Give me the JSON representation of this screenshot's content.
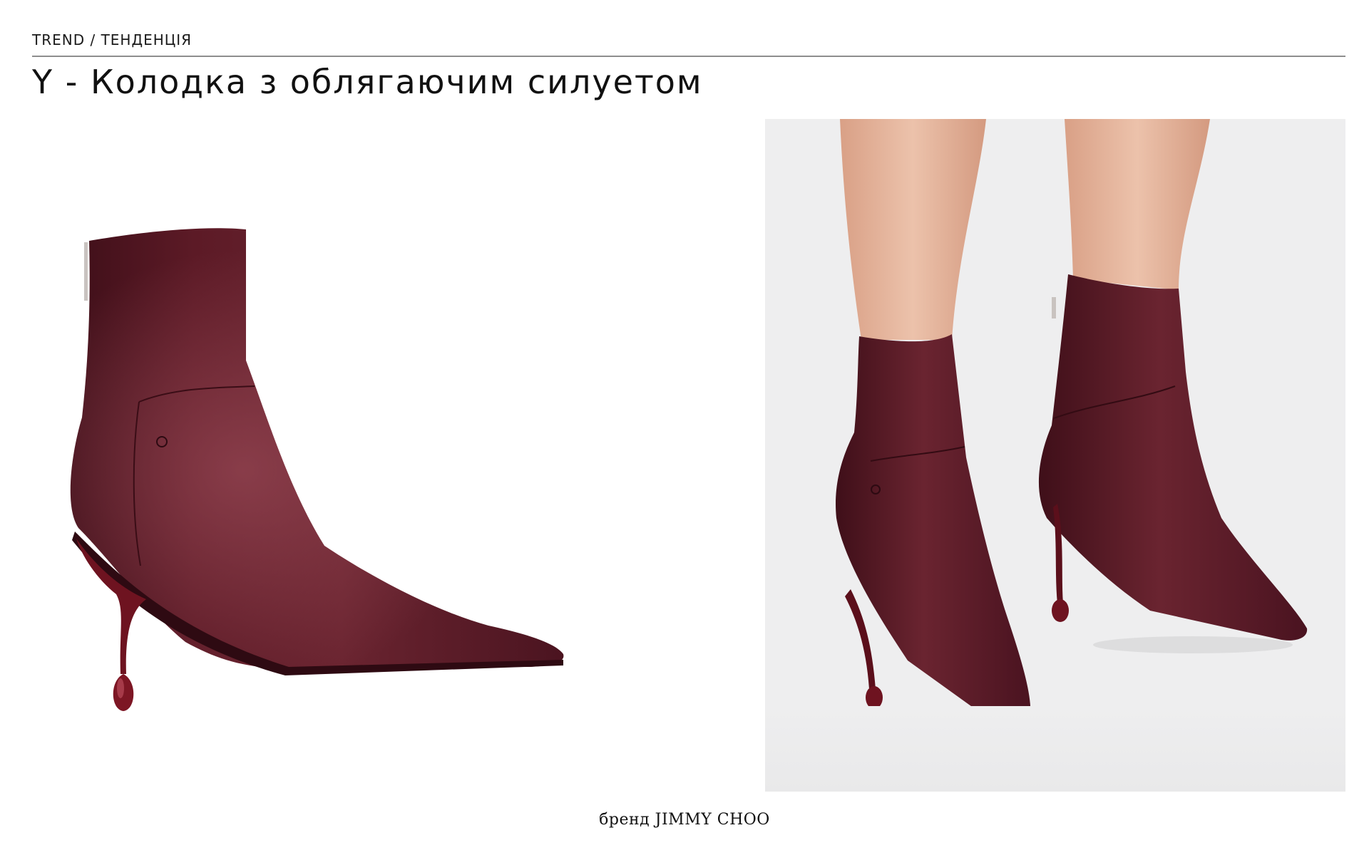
{
  "header": {
    "eyebrow": "TREND / ТЕНДЕНЦІЯ",
    "title": "Y - Колодка з облягаючим силуетом"
  },
  "footer": {
    "caption": "бренд JIMMY CHOO"
  },
  "colors": {
    "boot": "#5c1a26",
    "boot_shadow": "#3f0f19",
    "boot_highlight": "#8a3a47",
    "heel_lacquer": "#7d1624",
    "skin": "#e6b49b",
    "right_background": "#eeeeef"
  },
  "images": {
    "left": "burgundy-ankle-boot-side-view",
    "right": "model-wearing-burgundy-ankle-boots"
  }
}
